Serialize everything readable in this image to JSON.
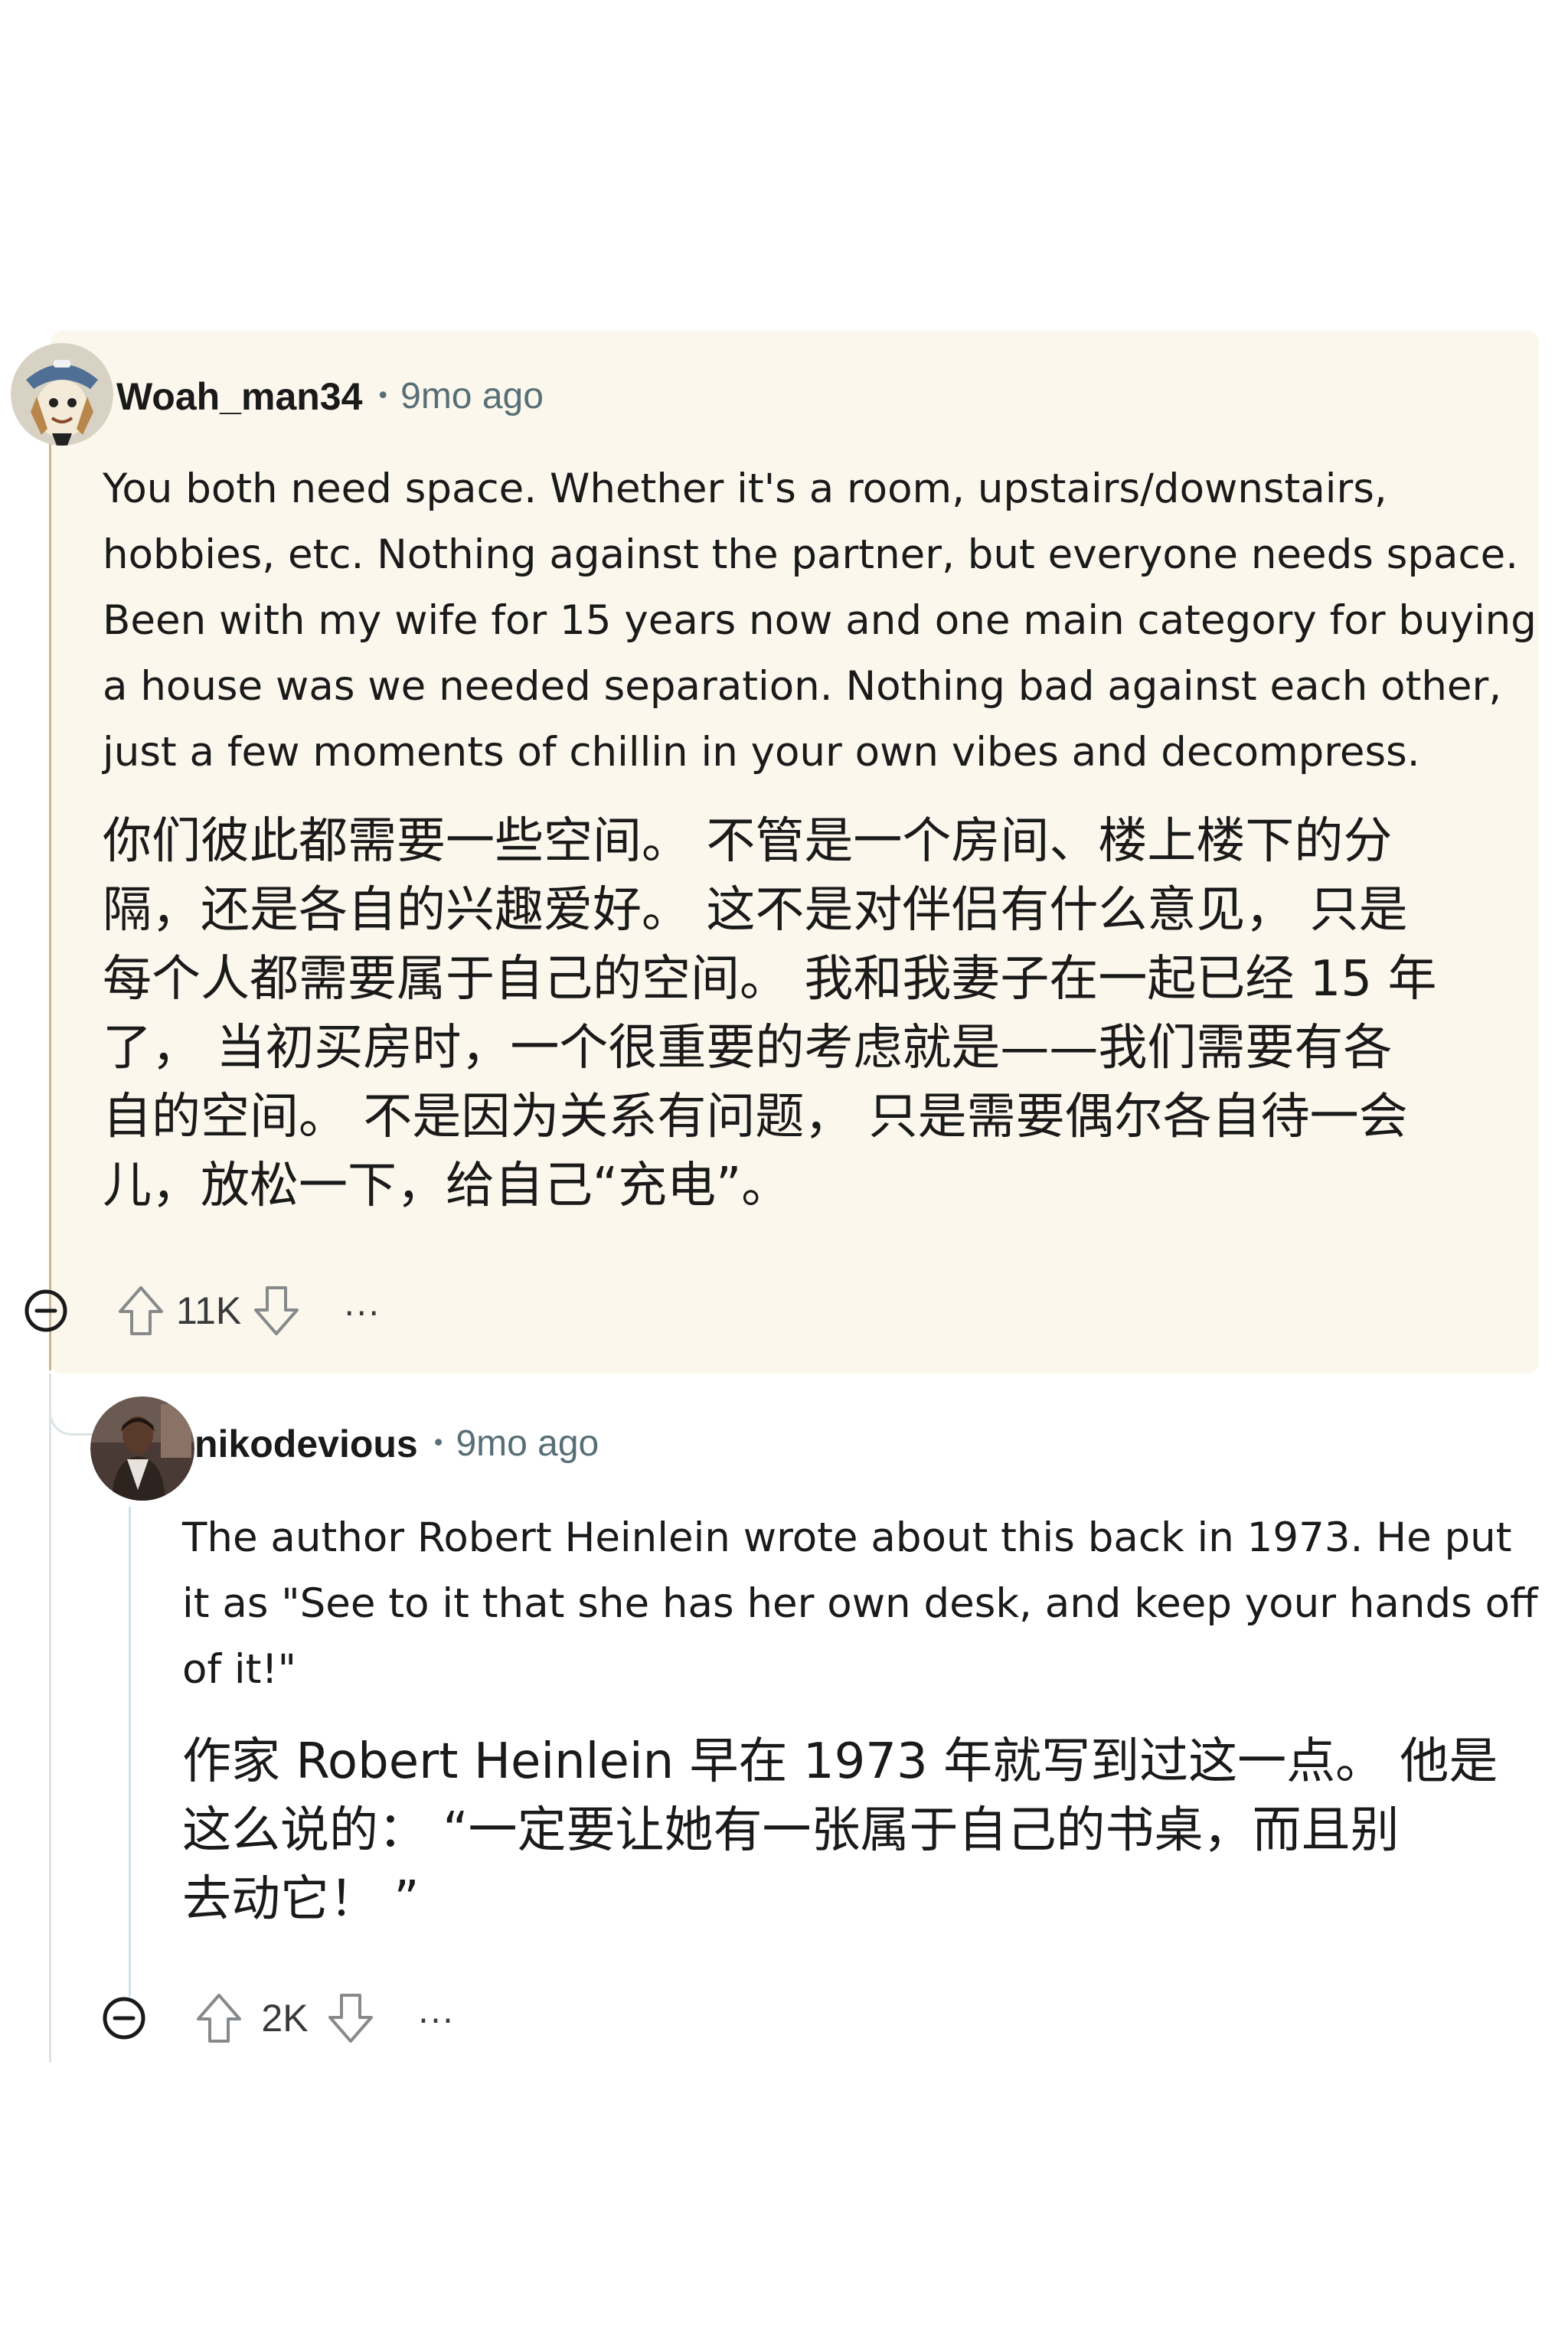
{
  "comments": [
    {
      "username": "Woah_man34",
      "separator": "•",
      "timestamp": "9mo ago",
      "body_en": [
        "You both need space. Whether it's a room, upstairs/downstairs,",
        "hobbies, etc. Nothing against the partner, but everyone needs space.",
        "Been with my wife for 15 years now and one main category for buying",
        "a house was we needed separation. Nothing bad against each other,",
        "just a few moments of chillin in your own vibes and decompress."
      ],
      "body_zh": [
        "你们彼此都需要一些空间。 不管是一个房间、楼上楼下的分",
        "隔，还是各自的兴趣爱好。 这不是对伴侣有什么意见， 只是",
        "每个人都需要属于自己的空间。 我和我妻子在一起已经 15 年",
        "了， 当初买房时，一个很重要的考虑就是——我们需要有各",
        "自的空间。 不是因为关系有问题， 只是需要偶尔各自待一会",
        "儿，放松一下，给自己“充电”。"
      ],
      "score": "11K",
      "more_label": "..."
    },
    {
      "username": "nikodevious",
      "separator": "•",
      "timestamp": "9mo ago",
      "body_en": [
        "The author Robert Heinlein wrote about this back in 1973. He put",
        "it as \"See to it that she has her own desk, and keep your hands off",
        "of it!\""
      ],
      "body_zh": [
        "作家 Robert Heinlein 早在 1973 年就写到过这一点。 他是",
        "这么说的： “一定要让她有一张属于自己的书桌，而且别",
        "去动它！ ”"
      ],
      "score": "2K",
      "more_label": "..."
    }
  ],
  "icons": {
    "collapse": "minus-circle-icon",
    "upvote": "arrow-up-icon",
    "downvote": "arrow-down-icon",
    "more": "ellipsis-icon"
  },
  "colors": {
    "highlight_bg": "#fbf7ec",
    "username": "#1a1a1b",
    "timestamp": "#576f76",
    "thread_line": "#dde3e6"
  }
}
